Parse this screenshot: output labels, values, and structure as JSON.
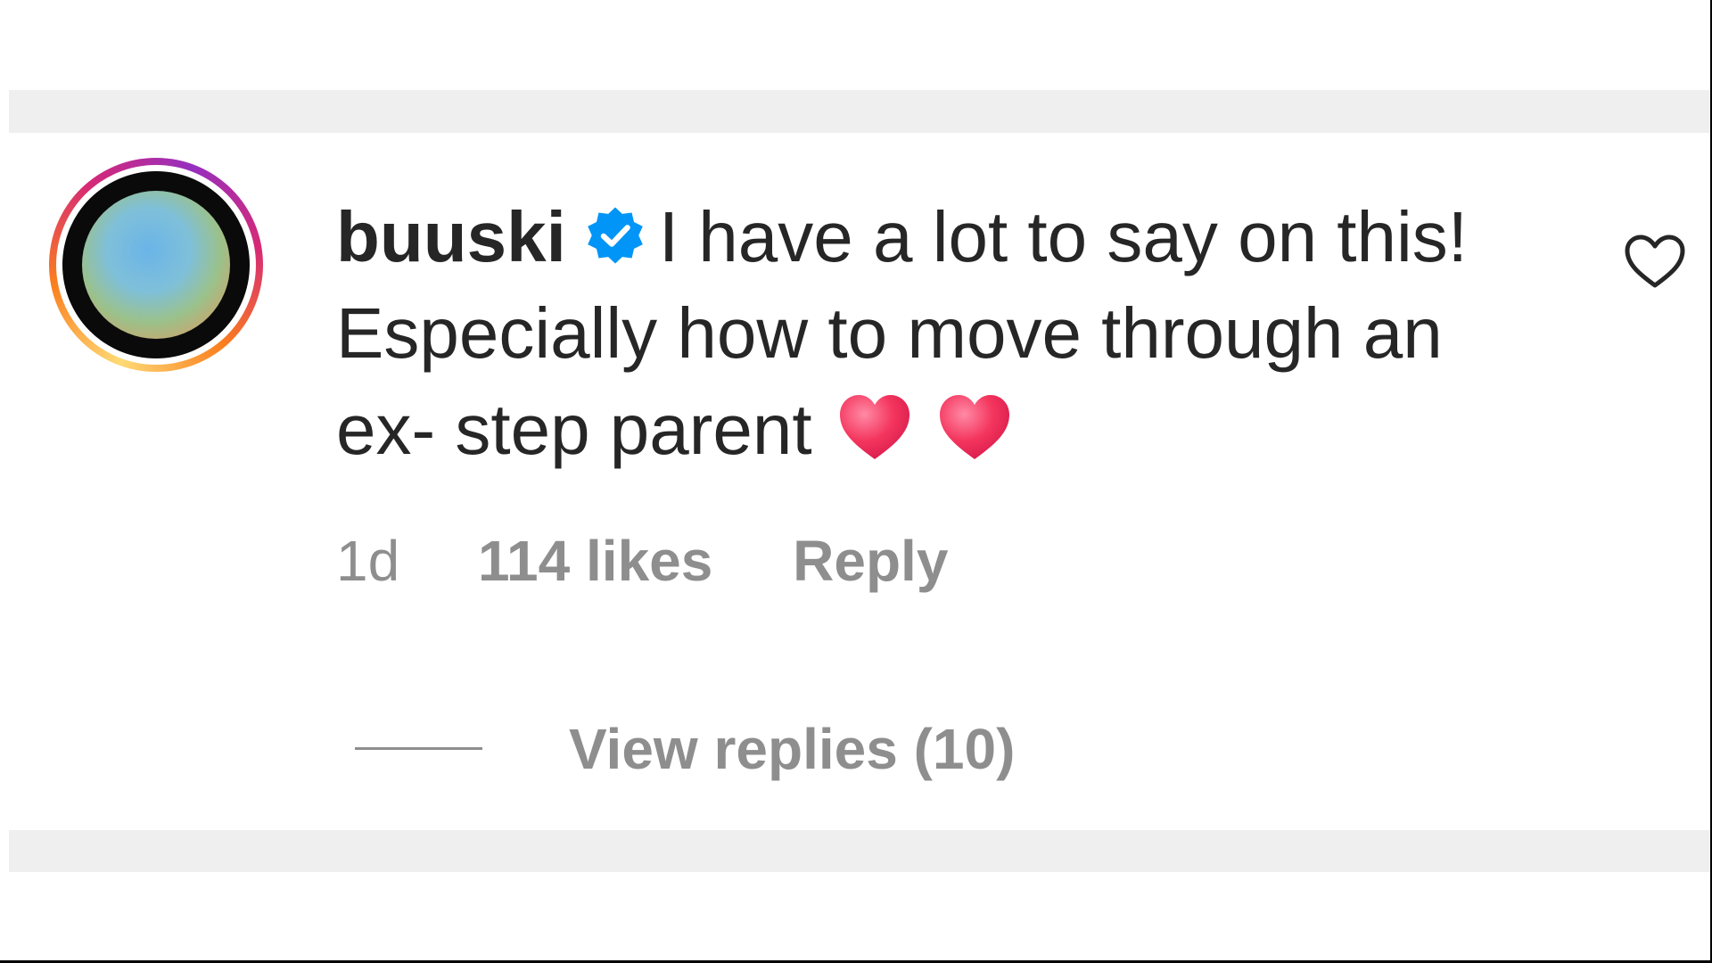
{
  "comment": {
    "username": "buuski",
    "text_line1": "I have a lot to say on this!",
    "text_line2": "Especially how to move through an",
    "text_line3": "ex- step parent",
    "emojis": [
      "red-heart",
      "red-heart"
    ],
    "time": "1d",
    "likes": "114 likes",
    "reply_label": "Reply",
    "view_replies": "View replies (10)",
    "liked": false
  },
  "colors": {
    "text_primary": "#262626",
    "text_secondary": "#8e8e8e",
    "verified_badge": "#0095f6",
    "band": "#efefef",
    "heart_emoji": "#f4365e"
  },
  "icons": {
    "like": "heart-outline-icon",
    "verified": "verified-badge-icon"
  }
}
